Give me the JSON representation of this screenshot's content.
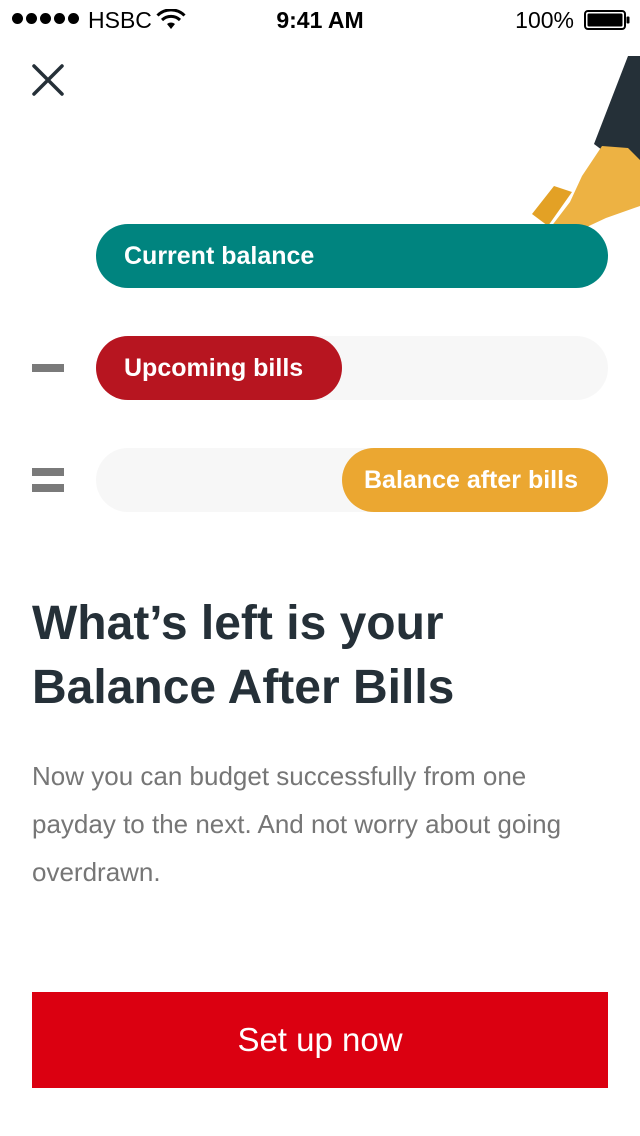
{
  "status_bar": {
    "carrier": "HSBC",
    "time": "9:41 AM",
    "battery": "100%",
    "signal_icon": "signal-dots-icon",
    "wifi_icon": "wifi-icon",
    "battery_icon": "battery-icon"
  },
  "header": {
    "close_icon": "close-icon"
  },
  "illustration": {
    "icon": "pointing-hand-illustration",
    "colors": {
      "sleeve": "#253038",
      "hand": "#eba731"
    }
  },
  "equation": {
    "current_balance_label": "Current balance",
    "upcoming_bills_label": "Upcoming bills",
    "balance_after_label": "Balance after bills",
    "minus_icon": "minus-icon",
    "equals_icon": "equals-icon",
    "colors": {
      "current": "#00847f",
      "upcoming": "#b71520",
      "after": "#eba731",
      "track": "#f7f7f7"
    }
  },
  "content": {
    "headline": "What’s left is your Balance After Bills",
    "body": "Now you can budget successfully from one payday to the next. And not worry about going overdrawn."
  },
  "cta": {
    "label": "Set up now",
    "color": "#db0011"
  }
}
